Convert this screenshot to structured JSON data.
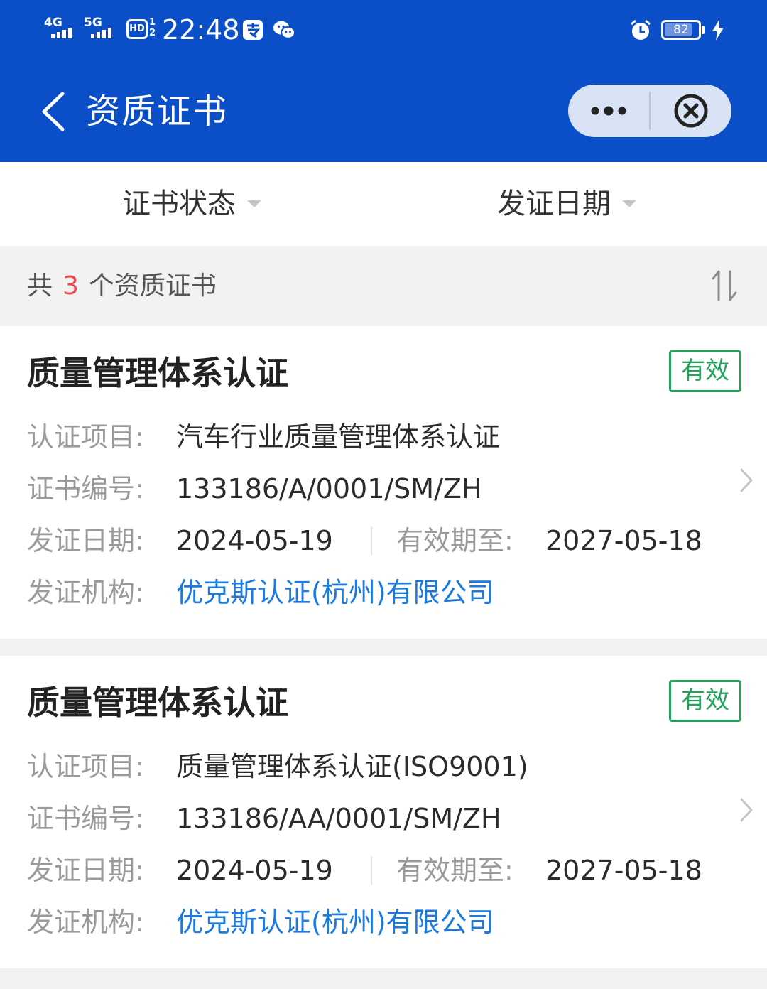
{
  "status_bar": {
    "network1": "4G",
    "network2": "5G",
    "hd_label": "HD",
    "hd_sub": "1 2",
    "time": "22:48",
    "battery_level": "82",
    "icons": [
      "signal-icon",
      "signal-icon",
      "hd-icon",
      "app-notification-icon",
      "wechat-icon",
      "alarm-icon",
      "battery-icon",
      "charging-icon"
    ]
  },
  "header": {
    "title": "资质证书",
    "back_icon": "chevron-left-icon",
    "more_icon": "more-dots-icon",
    "close_icon": "close-circle-icon",
    "background_color": "#0a4fc8"
  },
  "filters": [
    {
      "label": "证书状态",
      "icon": "caret-down-icon"
    },
    {
      "label": "发证日期",
      "icon": "caret-down-icon"
    }
  ],
  "summary": {
    "prefix": "共",
    "count": "3",
    "suffix": "个资质证书",
    "sort_icon": "sort-icon",
    "count_color": "#e9484c"
  },
  "certificates": [
    {
      "title": "质量管理体系认证",
      "status": "有效",
      "project_label": "认证项目:",
      "project": "汽车行业质量管理体系认证",
      "number_label": "证书编号:",
      "number": "133186/A/0001/SM/ZH",
      "issue_label": "发证日期:",
      "issue_date": "2024-05-19",
      "expiry_label": "有效期至:",
      "expiry_date": "2027-05-18",
      "org_label": "发证机构:",
      "org": "优克斯认证(杭州)有限公司"
    },
    {
      "title": "质量管理体系认证",
      "status": "有效",
      "project_label": "认证项目:",
      "project": "质量管理体系认证(ISO9001)",
      "number_label": "证书编号:",
      "number": "133186/AA/0001/SM/ZH",
      "issue_label": "发证日期:",
      "issue_date": "2024-05-19",
      "expiry_label": "有效期至:",
      "expiry_date": "2027-05-18",
      "org_label": "发证机构:",
      "org": "优克斯认证(杭州)有限公司"
    }
  ],
  "colors": {
    "status_valid": "#22a35a",
    "link": "#1a7ae0"
  }
}
